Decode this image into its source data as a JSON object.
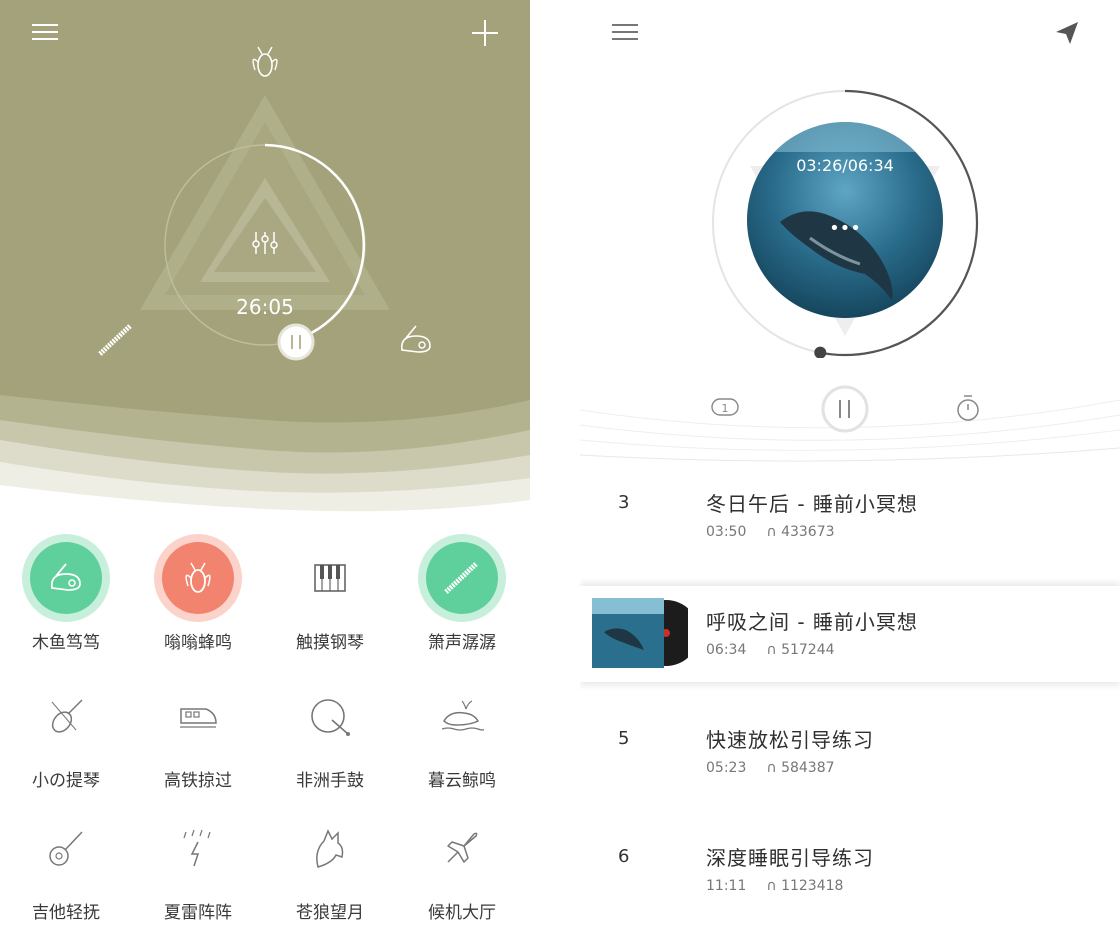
{
  "left": {
    "timer": "26:05",
    "colors": {
      "hero_bg": "#a3a27a",
      "green": "#5fcf9c",
      "coral": "#f2836f"
    },
    "icons": [
      "menu-icon",
      "plus-icon",
      "bee-icon",
      "sliders-icon",
      "pause-icon",
      "flute-icon",
      "woodfish-icon"
    ],
    "sounds": [
      {
        "label": "木鱼笃笃",
        "icon": "woodfish-icon"
      },
      {
        "label": "嗡嗡蜂鸣",
        "icon": "bee-icon"
      },
      {
        "label": "触摸钢琴",
        "icon": "piano-icon"
      },
      {
        "label": "箫声潺潺",
        "icon": "flute-icon"
      },
      {
        "label": "小の提琴",
        "icon": "violin-icon"
      },
      {
        "label": "高铁掠过",
        "icon": "train-icon"
      },
      {
        "label": "非洲手鼓",
        "icon": "drum-icon"
      },
      {
        "label": "暮云鲸鸣",
        "icon": "whale-icon"
      },
      {
        "label": "吉他轻抚",
        "icon": "guitar-icon"
      },
      {
        "label": "夏雷阵阵",
        "icon": "thunder-icon"
      },
      {
        "label": "苍狼望月",
        "icon": "wolf-icon"
      },
      {
        "label": "候机大厅",
        "icon": "airplane-icon"
      }
    ]
  },
  "right": {
    "time": "03:26/06:34",
    "progress": 0.53,
    "icons": [
      "menu-icon",
      "send-icon",
      "repeat-one-icon",
      "pause-icon",
      "timer-icon"
    ],
    "tracks": [
      {
        "num": "3",
        "title": "冬日午后 - 睡前小冥想",
        "duration": "03:50",
        "plays": "433673"
      },
      {
        "num": "",
        "title": "呼吸之间 - 睡前小冥想",
        "duration": "06:34",
        "plays": "517244"
      },
      {
        "num": "5",
        "title": "快速放松引导练习",
        "duration": "05:23",
        "plays": "584387"
      },
      {
        "num": "6",
        "title": "深度睡眠引导练习",
        "duration": "11:11",
        "plays": "1123418"
      }
    ]
  }
}
